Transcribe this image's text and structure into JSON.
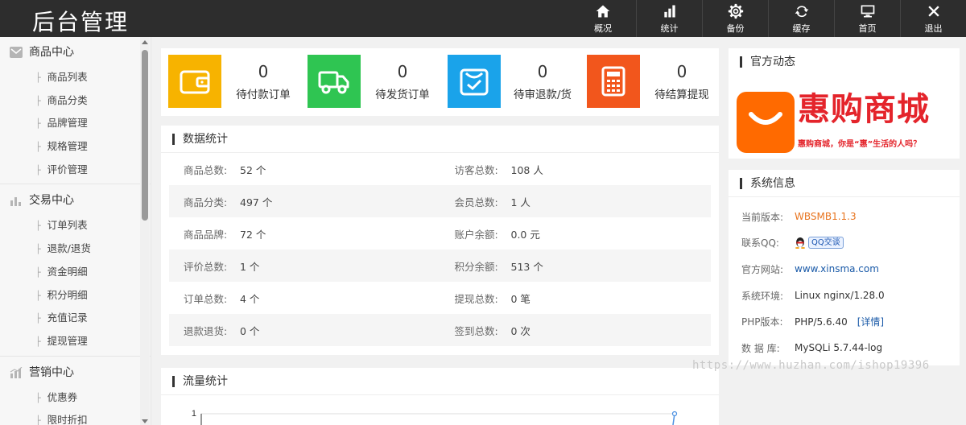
{
  "header": {
    "logo": "后台管理",
    "nav": [
      {
        "label": "概况",
        "icon": "home-icon"
      },
      {
        "label": "统计",
        "icon": "bar-chart-icon"
      },
      {
        "label": "备份",
        "icon": "gear-icon"
      },
      {
        "label": "缓存",
        "icon": "refresh-icon"
      },
      {
        "label": "首页",
        "icon": "monitor-icon"
      },
      {
        "label": "退出",
        "icon": "close-icon"
      }
    ]
  },
  "sidebar": {
    "groups": [
      {
        "title": "商品中心",
        "icon": "envelope-icon",
        "items": [
          "商品列表",
          "商品分类",
          "品牌管理",
          "规格管理",
          "评价管理"
        ]
      },
      {
        "title": "交易中心",
        "icon": "bar-chart-icon",
        "items": [
          "订单列表",
          "退款/退货",
          "资金明细",
          "积分明细",
          "充值记录",
          "提现管理"
        ]
      },
      {
        "title": "营销中心",
        "icon": "chart-icon",
        "items": [
          "优惠券",
          "限时折扣"
        ]
      }
    ]
  },
  "stats": [
    {
      "value": "0",
      "label": "待付款订单",
      "color": "#f7b300",
      "icon": "wallet-icon"
    },
    {
      "value": "0",
      "label": "待发货订单",
      "color": "#2fc552",
      "icon": "truck-icon"
    },
    {
      "value": "0",
      "label": "待审退款/货",
      "color": "#1aa3ea",
      "icon": "cart-check-icon"
    },
    {
      "value": "0",
      "label": "待结算提现",
      "color": "#f2561c",
      "icon": "calculator-icon"
    }
  ],
  "data_stats": {
    "title": "数据统计",
    "rows": [
      {
        "k1": "商品总数:",
        "v1": "52 个",
        "k2": "访客总数:",
        "v2": "108 人"
      },
      {
        "k1": "商品分类:",
        "v1": "497 个",
        "k2": "会员总数:",
        "v2": "1 人"
      },
      {
        "k1": "商品品牌:",
        "v1": "72 个",
        "k2": "账户余额:",
        "v2": "0.0 元"
      },
      {
        "k1": "评价总数:",
        "v1": "1 个",
        "k2": "积分余额:",
        "v2": "513 个"
      },
      {
        "k1": "订单总数:",
        "v1": "4 个",
        "k2": "提现总数:",
        "v2": "0 笔"
      },
      {
        "k1": "退款退货:",
        "v1": "0 个",
        "k2": "签到总数:",
        "v2": "0 次"
      }
    ]
  },
  "traffic": {
    "title": "流量统计",
    "y_tick": "1"
  },
  "news": {
    "title": "官方动态",
    "banner_text": "惠购商城",
    "banner_sub": "惠购商城，你是“惠”生活的人吗？"
  },
  "sysinfo": {
    "title": "系统信息",
    "version_label": "当前版本:",
    "version_value": "WBSMB1.1.3",
    "qq_label": "联系QQ:",
    "qq_value": "QQ交谈",
    "site_label": "官方网站:",
    "site_value": "www.xinsma.com",
    "env_label": "系统环境:",
    "env_value": "Linux nginx/1.28.0",
    "php_label": "PHP版本:",
    "php_value": "PHP/5.6.40",
    "php_detail": "[详情]",
    "db_label": "数 据 库:",
    "db_value": "MySQLi 5.7.44-log"
  },
  "watermark": "https://www.huzhan.com/ishop19396"
}
